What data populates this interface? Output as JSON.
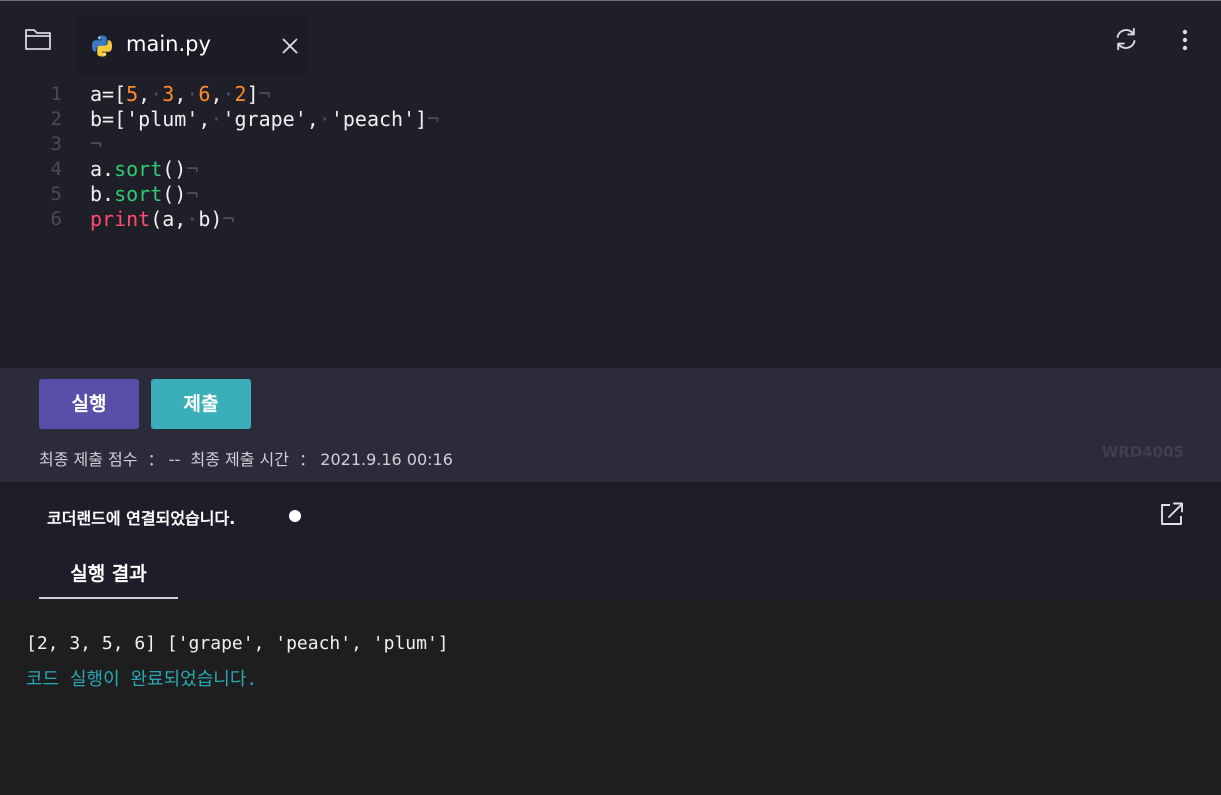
{
  "tab": {
    "filename": "main.py"
  },
  "editor": {
    "lines": [
      {
        "number": "1",
        "segments": [
          {
            "t": "a=[",
            "c": "plain"
          },
          {
            "t": "5",
            "c": "num"
          },
          {
            "t": ",",
            "c": "plain"
          },
          {
            "t": "·",
            "c": "ws"
          },
          {
            "t": "3",
            "c": "num"
          },
          {
            "t": ",",
            "c": "plain"
          },
          {
            "t": "·",
            "c": "ws"
          },
          {
            "t": "6",
            "c": "num"
          },
          {
            "t": ",",
            "c": "plain"
          },
          {
            "t": "·",
            "c": "ws"
          },
          {
            "t": "2",
            "c": "num"
          },
          {
            "t": "]",
            "c": "plain"
          },
          {
            "t": "¬",
            "c": "ws"
          }
        ]
      },
      {
        "number": "2",
        "segments": [
          {
            "t": "b=['plum',",
            "c": "plain"
          },
          {
            "t": "·",
            "c": "ws"
          },
          {
            "t": "'grape',",
            "c": "plain"
          },
          {
            "t": "·",
            "c": "ws"
          },
          {
            "t": "'peach']",
            "c": "plain"
          },
          {
            "t": "¬",
            "c": "ws"
          }
        ]
      },
      {
        "number": "3",
        "segments": [
          {
            "t": "¬",
            "c": "ws"
          }
        ]
      },
      {
        "number": "4",
        "segments": [
          {
            "t": "a.",
            "c": "plain"
          },
          {
            "t": "sort",
            "c": "fn"
          },
          {
            "t": "()",
            "c": "plain"
          },
          {
            "t": "¬",
            "c": "ws"
          }
        ]
      },
      {
        "number": "5",
        "segments": [
          {
            "t": "b.",
            "c": "plain"
          },
          {
            "t": "sort",
            "c": "fn"
          },
          {
            "t": "()",
            "c": "plain"
          },
          {
            "t": "¬",
            "c": "ws"
          }
        ]
      },
      {
        "number": "6",
        "segments": [
          {
            "t": "print",
            "c": "kw"
          },
          {
            "t": "(a,",
            "c": "plain"
          },
          {
            "t": "·",
            "c": "ws"
          },
          {
            "t": "b)",
            "c": "plain"
          },
          {
            "t": "¬",
            "c": "ws"
          }
        ]
      }
    ]
  },
  "actions": {
    "run_label": "실행",
    "submit_label": "제출"
  },
  "submission": {
    "score_label": "최종 제출 점수",
    "score_value": "--",
    "time_label": "최종 제출 시간",
    "time_value": "2021.9.16 00:16",
    "separator": "：",
    "code_id": "WRD4005"
  },
  "status": {
    "connection_text": "코더랜드에 연결되었습니다.",
    "result_tab_label": "실행 결과"
  },
  "console": {
    "output_line": "[2, 3, 5, 6] ['grape', 'peach', 'plum']",
    "done_line": "코드 실행이 완료되었습니다."
  },
  "colors": {
    "editor_bg": "#1f1f2a",
    "panel_bg": "#2b2b3b",
    "console_bg": "#1e1e1e",
    "run_button": "#5a4fa8",
    "submit_button": "#3aafb9",
    "number_literal": "#ff8a2a",
    "method_name": "#2ecc71",
    "builtin_print": "#ff4d6d",
    "done_text": "#27a8b5"
  },
  "icons": {
    "folder": "folder-icon",
    "python": "python-icon",
    "close": "close-icon",
    "refresh": "refresh-icon",
    "more": "more-vertical-icon",
    "external": "external-link-icon"
  }
}
